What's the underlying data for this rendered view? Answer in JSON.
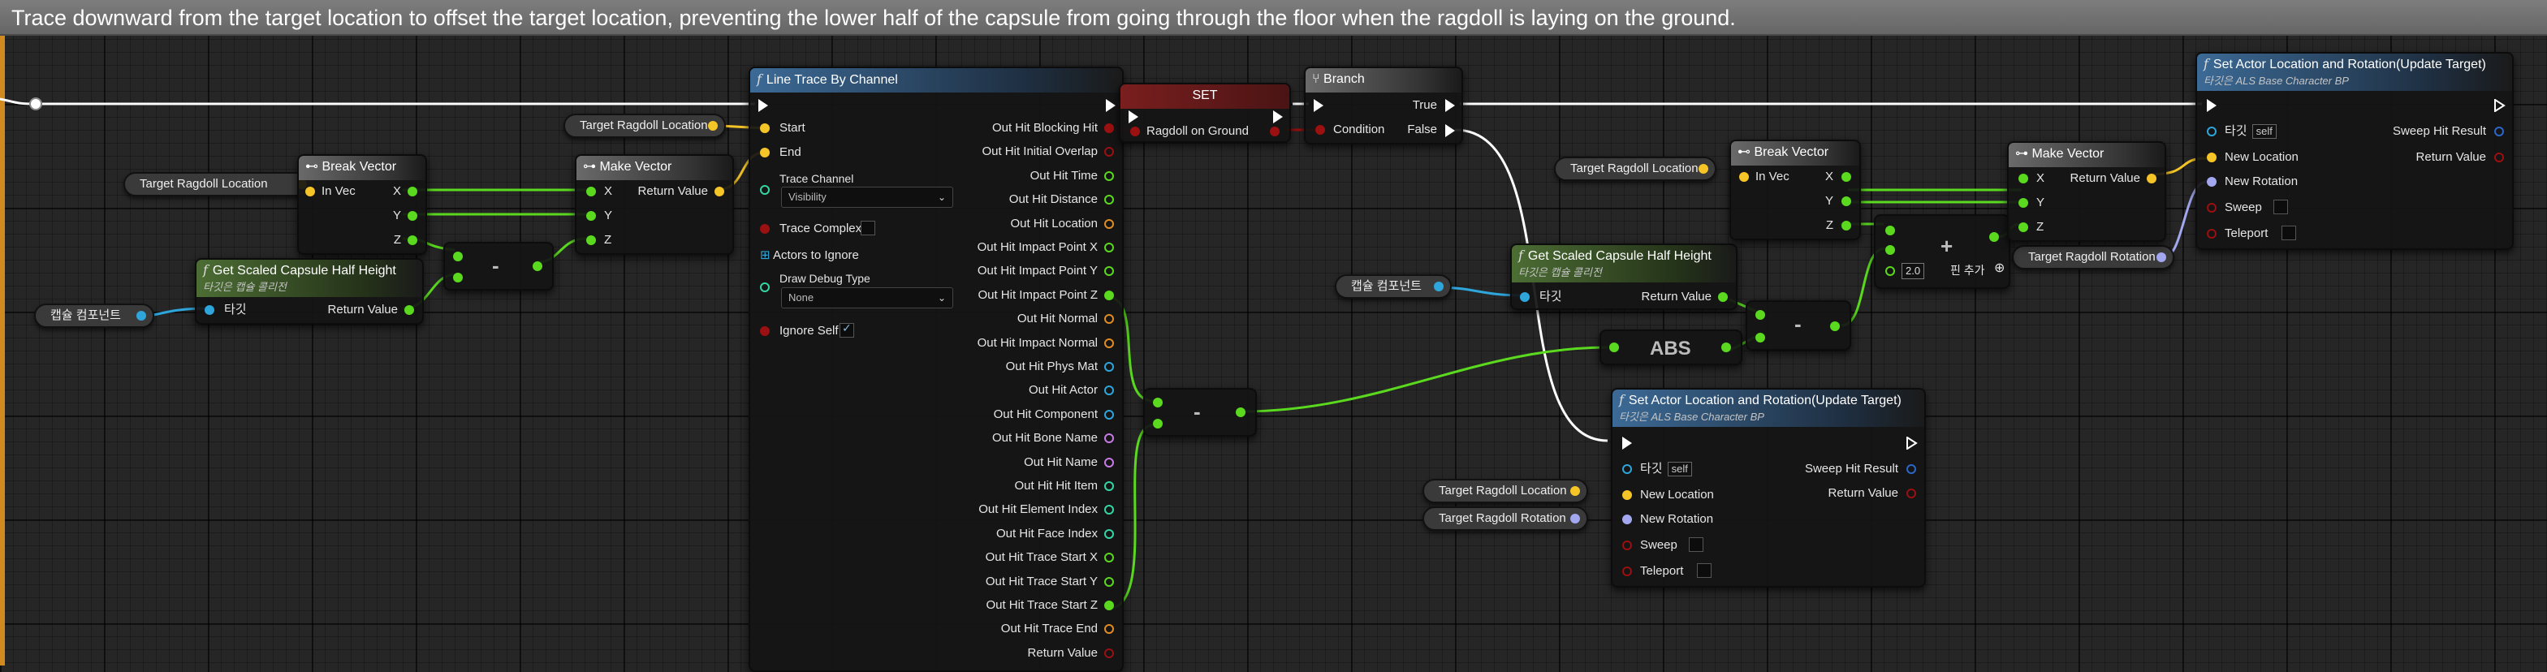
{
  "comment": "Trace downward from the target location to offset the target location, preventing the lower half of the capsule from going through the floor when the ragdoll is laying on the ground.",
  "colors": {
    "exec": "#ffffff",
    "vector": "#f5c528",
    "float": "#5ad91f",
    "object": "#2ea6dc",
    "bool": "#9b1010",
    "rotator": "#a3a7ef",
    "struct": "#2a67c9",
    "name": "#c87be6",
    "int": "#34d6a3",
    "string": "#e53dba",
    "struct_orange": "#e08c22"
  },
  "vars": {
    "target_ragdoll_location": "Target Ragdoll Location",
    "target_ragdoll_rotation": "Target Ragdoll Rotation",
    "capsule_component": "캡슐 컴포넌트"
  },
  "break_vector": {
    "title": "Break Vector",
    "in_vec": "In Vec",
    "x": "X",
    "y": "Y",
    "z": "Z"
  },
  "make_vector": {
    "title": "Make Vector",
    "x": "X",
    "y": "Y",
    "z": "Z",
    "return_value": "Return Value"
  },
  "capsule_half_height": {
    "title": "Get Scaled Capsule Half Height",
    "subtitle": "타깃은 캡슐 콜리전",
    "target": "타깃",
    "return_value": "Return Value"
  },
  "minus_label": "-",
  "abs_label": "ABS",
  "plus_label": "+",
  "add_pin_label": "핀 추가",
  "add_default_value": "2.0",
  "line_trace": {
    "title": "Line Trace By Channel",
    "start": "Start",
    "end": "End",
    "trace_channel_label": "Trace Channel",
    "trace_channel_value": "Visibility",
    "trace_complex": "Trace Complex",
    "actors_to_ignore": "Actors to Ignore",
    "draw_debug_type_label": "Draw Debug Type",
    "draw_debug_type_value": "None",
    "ignore_self": "Ignore Self",
    "outputs": [
      {
        "label": "Out Hit Blocking Hit",
        "type": "bool"
      },
      {
        "label": "Out Hit Initial Overlap",
        "type": "bool"
      },
      {
        "label": "Out Hit Time",
        "type": "float"
      },
      {
        "label": "Out Hit Distance",
        "type": "float"
      },
      {
        "label": "Out Hit Location",
        "type": "struct_orange"
      },
      {
        "label": "Out Hit Impact Point X",
        "type": "float"
      },
      {
        "label": "Out Hit Impact Point Y",
        "type": "float"
      },
      {
        "label": "Out Hit Impact Point Z",
        "type": "float"
      },
      {
        "label": "Out Hit Normal",
        "type": "struct_orange"
      },
      {
        "label": "Out Hit Impact Normal",
        "type": "struct_orange"
      },
      {
        "label": "Out Hit Phys Mat",
        "type": "object"
      },
      {
        "label": "Out Hit Actor",
        "type": "object"
      },
      {
        "label": "Out Hit Component",
        "type": "object"
      },
      {
        "label": "Out Hit Bone Name",
        "type": "name"
      },
      {
        "label": "Out Hit Name",
        "type": "name"
      },
      {
        "label": "Out Hit Hit Item",
        "type": "int"
      },
      {
        "label": "Out Hit Element Index",
        "type": "int"
      },
      {
        "label": "Out Hit Face Index",
        "type": "int"
      },
      {
        "label": "Out Hit Trace Start X",
        "type": "float"
      },
      {
        "label": "Out Hit Trace Start Y",
        "type": "float"
      },
      {
        "label": "Out Hit Trace Start Z",
        "type": "float"
      },
      {
        "label": "Out Hit Trace End",
        "type": "struct_orange"
      },
      {
        "label": "Return Value",
        "type": "bool"
      }
    ]
  },
  "set_node": {
    "title": "SET",
    "var": "Ragdoll on Ground"
  },
  "branch": {
    "title": "Branch",
    "condition": "Condition",
    "true": "True",
    "false": "False"
  },
  "set_actor": {
    "title": "Set Actor Location and Rotation(Update Target)",
    "subtitle": "타깃은 ALS Base Character BP",
    "target": "타깃",
    "self": "self",
    "new_location": "New Location",
    "new_rotation": "New Rotation",
    "sweep": "Sweep",
    "teleport": "Teleport",
    "sweep_hit_result": "Sweep Hit Result",
    "return_value": "Return Value"
  }
}
